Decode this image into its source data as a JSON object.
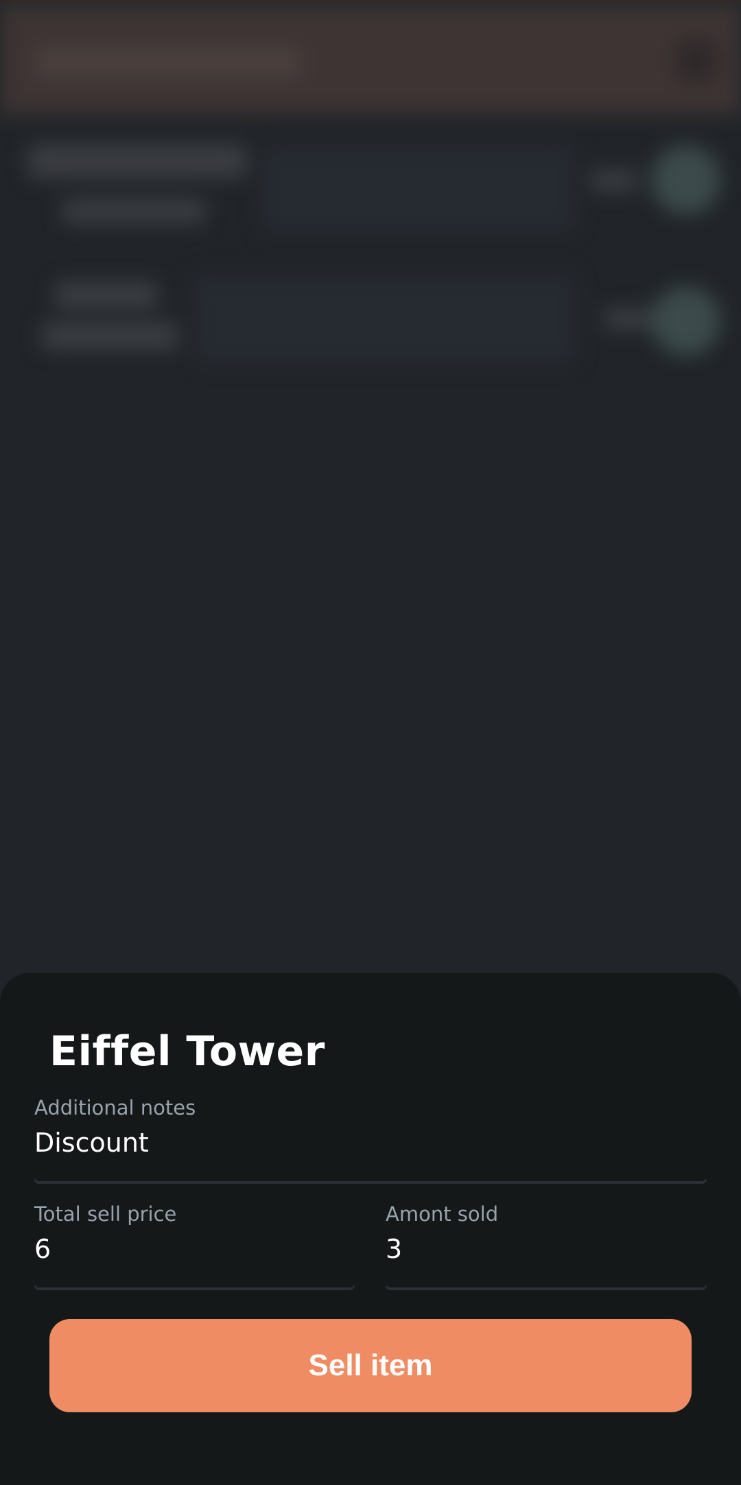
{
  "sheet": {
    "title": "Eiffel Tower",
    "notes_label": "Additional notes",
    "notes_value": "Discount",
    "price_label": "Total sell price",
    "price_value": "6",
    "amount_label": "Amont sold",
    "amount_value": "3",
    "sell_button_label": "Sell item"
  },
  "colors": {
    "accent": "#ef8c63",
    "sheet_background": "#151819",
    "page_background": "#212529",
    "label_text": "#98a3ad"
  }
}
